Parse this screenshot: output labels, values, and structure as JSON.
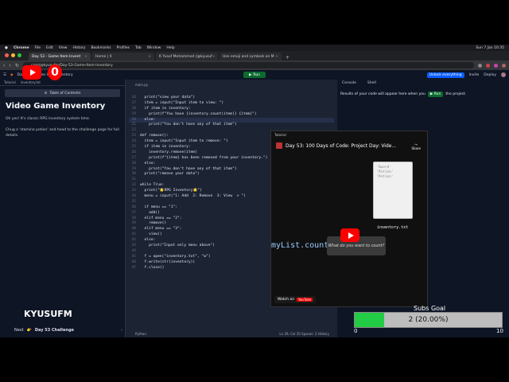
{
  "menubar": {
    "items": [
      "Chrome",
      "File",
      "Edit",
      "View",
      "History",
      "Bookmarks",
      "Profiles",
      "Tab",
      "Window",
      "Help"
    ],
    "clock": "Sun 7 Jan 10:35"
  },
  "tabs": [
    {
      "label": "Day 53 - Game Item Invent"
    },
    {
      "label": "Home | X"
    },
    {
      "label": "K Yusuf Mohammed (@kyusuf"
    },
    {
      "label": "Use emoji and symbols on M"
    }
  ],
  "address": {
    "url": "...com/@kyusufm/Day-53-Game-Item-Inventory"
  },
  "replit": {
    "project": "Day 53 -- Game Item Inventory",
    "run": "Run",
    "upgrade": "Unlock everything",
    "invite": "Invite",
    "deploy": "Deploy"
  },
  "left": {
    "tabs": [
      "Tutorial",
      "inventory.txt"
    ],
    "toc": "Table of Contents",
    "title": "Video Game Inventory",
    "p1": "Oh yes! It's classic RPG inventory system time.",
    "p2": "Chug a 'stamina potion' and head to the challenge page for full details.",
    "next_label": "Next",
    "next_value": "Day 53 Challenge"
  },
  "editor": {
    "file": "main.py",
    "lines": [
      {
        "n": "16",
        "t": "  print(\"view your data\")"
      },
      {
        "n": "17",
        "t": "  item = input(\"Input item to view: \")"
      },
      {
        "n": "18",
        "t": "  if item in inventory:"
      },
      {
        "n": "19",
        "t": "    print(f\"You have {inventory.count(item)} {item}\")"
      },
      {
        "n": "20",
        "t": "  else:"
      },
      {
        "n": "21",
        "t": "    print(\"You don't have any of that item\")"
      },
      {
        "n": "22",
        "t": ""
      },
      {
        "n": "23",
        "t": "def remove():"
      },
      {
        "n": "24",
        "t": "  item = input(\"Input item to remove: \")"
      },
      {
        "n": "25",
        "t": "  if item in inventory:"
      },
      {
        "n": "26",
        "t": "    inventory.remove(item)"
      },
      {
        "n": "27",
        "t": "    print(f\"{item} has been removed from your inventory.\")"
      },
      {
        "n": "28",
        "t": "  else:"
      },
      {
        "n": "29",
        "t": "    print(\"You don't have any of that item\")"
      },
      {
        "n": "30",
        "t": "  print(\"remove your data\")"
      },
      {
        "n": "31",
        "t": ""
      },
      {
        "n": "32",
        "t": "while True:"
      },
      {
        "n": "33",
        "t": "  print(\"🌟RPG Inventory🌟\")"
      },
      {
        "n": "34",
        "t": "  menu = input(\"1: Add  2: Remove  3: View  > \")"
      },
      {
        "n": "35",
        "t": ""
      },
      {
        "n": "36",
        "t": "  if menu == \"1\":"
      },
      {
        "n": "37",
        "t": "    add()"
      },
      {
        "n": "38",
        "t": "  elif menu == \"2\":"
      },
      {
        "n": "39",
        "t": "    remove()"
      },
      {
        "n": "40",
        "t": "  elif menu == \"3\":"
      },
      {
        "n": "41",
        "t": "    view()"
      },
      {
        "n": "42",
        "t": "  else:"
      },
      {
        "n": "43",
        "t": "    print(\"Input only menu above\")"
      },
      {
        "n": "44",
        "t": ""
      },
      {
        "n": "45",
        "t": "  f = open(\"inventory.txt\", \"w\")"
      },
      {
        "n": "46",
        "t": "  f.write(str(inventory))"
      },
      {
        "n": "47",
        "t": "  f.close()"
      }
    ],
    "status_left": "Python",
    "status_right": "Ln 29, Col 35   Spaces: 2   History"
  },
  "console": {
    "tabs": [
      "Console",
      "Shell"
    ],
    "msg_a": "Results of your code will appear here when you",
    "run": "Run",
    "msg_b": "the project."
  },
  "video": {
    "bar": "Tutorial",
    "title": "Day 53: 100 Days of Code: Project Day: Vide...",
    "share": "Share",
    "paper": "'Sword'\n'Potion'\n'Potion'",
    "file": "inventory.txt",
    "code": "myList.count(",
    "bubble": "What do you want to count?",
    "watch": "Watch on",
    "yt": "YouTube"
  },
  "overlay": {
    "live_count": "0",
    "username": "KYUSUFM",
    "goal_title": "Subs Goal",
    "goal_text": "2 (20.00%)",
    "goal_min": "0",
    "goal_max": "10",
    "goal_fraction": 0.2
  }
}
